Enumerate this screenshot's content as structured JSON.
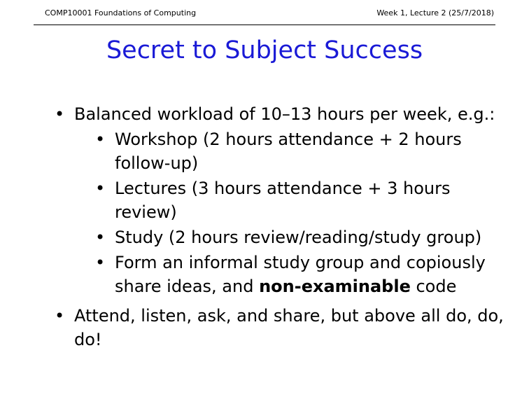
{
  "header": {
    "course": "COMP10001 Foundations of Computing",
    "lecture": "Week 1, Lecture 2 (25/7/2018)"
  },
  "slide": {
    "title": "Secret to Subject Success",
    "bullets": [
      {
        "text": "Balanced workload of 10–13 hours per week, e.g.:",
        "sub": [
          {
            "text": "Workshop (2 hours attendance + 2 hours follow-up)"
          },
          {
            "text": "Lectures (3 hours attendance + 3 hours review)"
          },
          {
            "text": "Study (2 hours review/reading/study group)"
          },
          {
            "before": "Form an informal study group and copiously share ideas, and ",
            "bold": "non-examinable",
            "after": " code"
          }
        ]
      },
      {
        "text": "Attend, listen, ask, and share, but above all do, do, do!"
      }
    ],
    "bullet_glyph": "•"
  }
}
